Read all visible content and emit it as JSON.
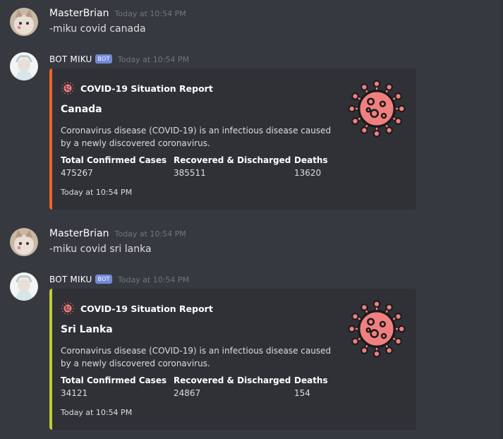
{
  "messages": [
    {
      "username": "MasterBrian",
      "timestamp": "Today at 10:54 PM",
      "content": "-miku covid canada"
    },
    {
      "username": "BOT MIKU",
      "bot_tag": "BOT",
      "timestamp": "Today at 10:54 PM",
      "embed": {
        "accent": "#f26522",
        "author": "COVID-19 Situation Report",
        "title": "Canada",
        "description": "Coronavirus disease (COVID-19) is an infectious disease caused by a newly discovered coronavirus.",
        "fields": [
          {
            "name": "Total Confirmed Cases",
            "value": "475267"
          },
          {
            "name": "Recovered & Discharged",
            "value": "385511"
          },
          {
            "name": "Deaths",
            "value": "13620"
          }
        ],
        "footer": "Today at 10:54 PM",
        "thumbnail_icon": "virus-icon"
      }
    },
    {
      "username": "MasterBrian",
      "timestamp": "Today at 10:54 PM",
      "content": "-miku covid sri lanka"
    },
    {
      "username": "BOT MIKU",
      "bot_tag": "BOT",
      "timestamp": "Today at 10:54 PM",
      "embed": {
        "accent": "#c4cc2e",
        "author": "COVID-19 Situation Report",
        "title": "Sri Lanka",
        "description": "Coronavirus disease (COVID-19) is an infectious disease caused by a newly discovered coronavirus.",
        "fields": [
          {
            "name": "Total Confirmed Cases",
            "value": "34121"
          },
          {
            "name": "Recovered & Discharged",
            "value": "24867"
          },
          {
            "name": "Deaths",
            "value": "154"
          }
        ],
        "footer": "Today at 10:54 PM",
        "thumbnail_icon": "virus-icon"
      }
    }
  ],
  "colors": {
    "background": "#36393f",
    "embed_bg": "#2f3136",
    "bot_tag": "#7289da",
    "virus": "#f08080"
  }
}
